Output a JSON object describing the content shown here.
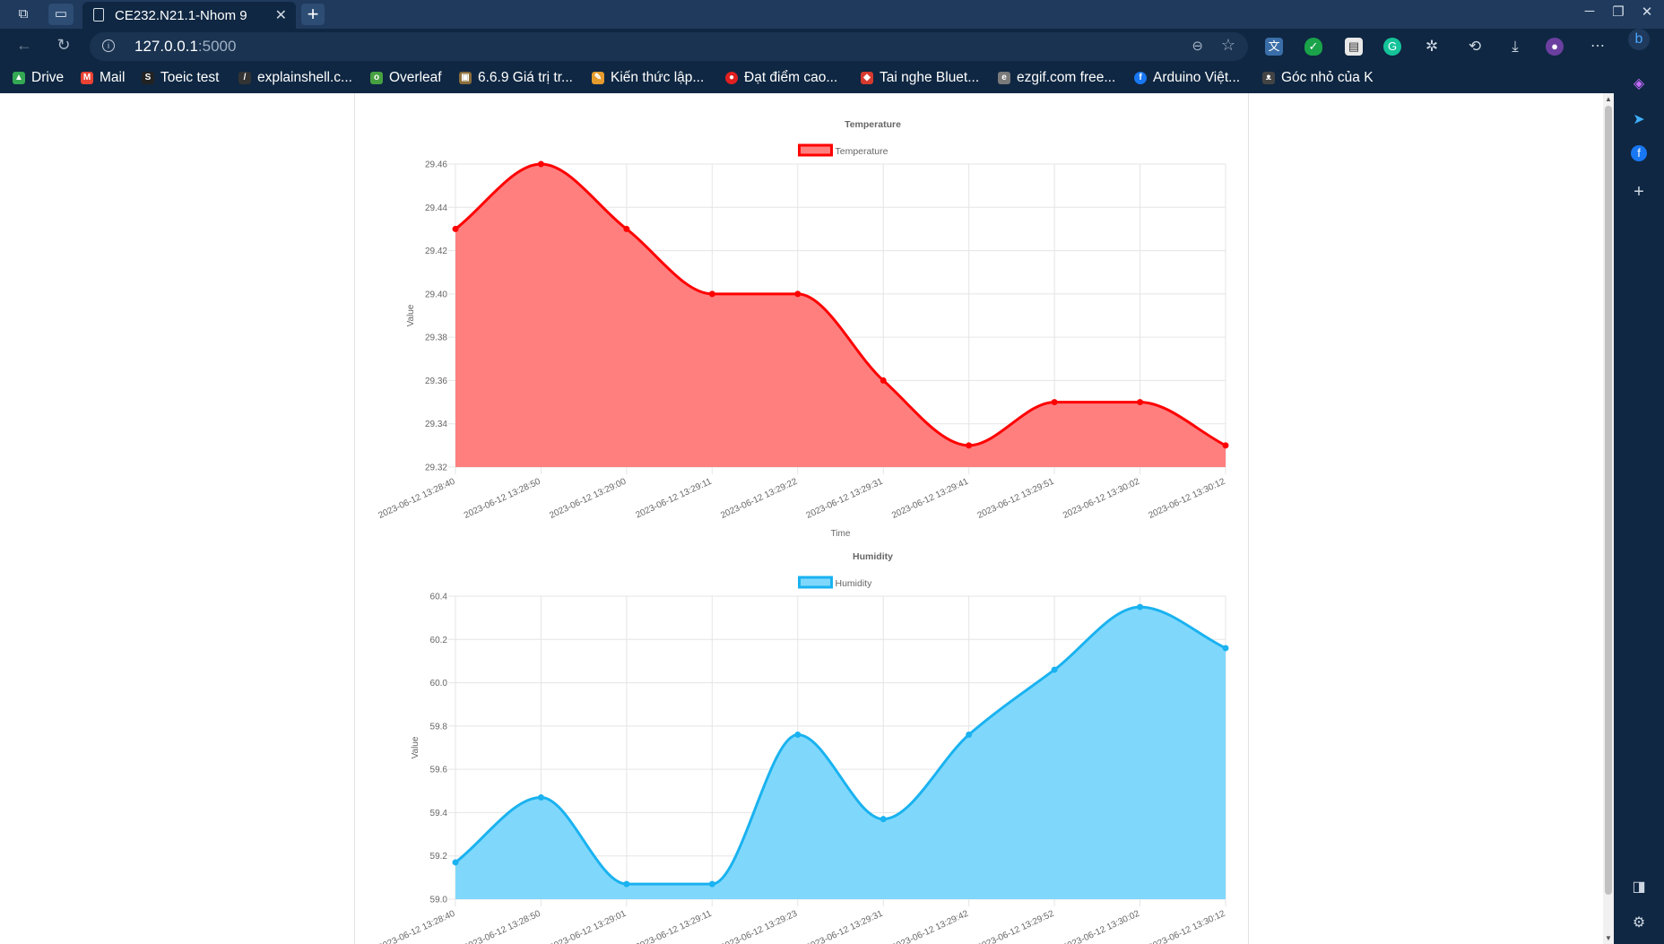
{
  "browser": {
    "tab_title": "CE232.N21.1-Nhom 9",
    "url_host": "127.0.0.1",
    "url_port": ":5000",
    "bookmarks": [
      {
        "label": "Drive",
        "icon": "drive-icon",
        "color": "#34a853"
      },
      {
        "label": "Mail",
        "icon": "gmail-icon",
        "color": "#ea4335"
      },
      {
        "label": "Toeic test",
        "icon": "toeic-icon",
        "color": "#222222"
      },
      {
        "label": "explainshell.c...",
        "icon": "explainshell-icon",
        "color": "#333333"
      },
      {
        "label": "Overleaf",
        "icon": "overleaf-icon",
        "color": "#47a141"
      },
      {
        "label": "6.6.9 Giá trị tr...",
        "icon": "site-icon",
        "color": "#8a6d3b"
      },
      {
        "label": "Kiến thức lập...",
        "icon": "pencil-icon",
        "color": "#e69b2d"
      },
      {
        "label": "Đạt điểm cao...",
        "icon": "red-circle-icon",
        "color": "#e02020"
      },
      {
        "label": "Tai nghe Bluet...",
        "icon": "shop-icon",
        "color": "#d63a2f"
      },
      {
        "label": "ezgif.com free...",
        "icon": "ezgif-icon",
        "color": "#7a7a7a"
      },
      {
        "label": "Arduino Việt...",
        "icon": "facebook-icon",
        "color": "#1877f2"
      },
      {
        "label": "Góc nhỏ của K",
        "icon": "cat-icon",
        "color": "#444444"
      }
    ]
  },
  "chart_data": [
    {
      "type": "area",
      "title": "Temperature",
      "legend": "Temperature",
      "xlabel": "Time",
      "ylabel": "Value",
      "color": "#ff0000",
      "fill": "#ff7f7f",
      "categories": [
        "2023-06-12 13:28:40",
        "2023-06-12 13:28:50",
        "2023-06-12 13:29:00",
        "2023-06-12 13:29:11",
        "2023-06-12 13:29:22",
        "2023-06-12 13:29:31",
        "2023-06-12 13:29:41",
        "2023-06-12 13:29:51",
        "2023-06-12 13:30:02",
        "2023-06-12 13:30:12"
      ],
      "values": [
        29.43,
        29.46,
        29.43,
        29.4,
        29.4,
        29.36,
        29.33,
        29.35,
        29.35,
        29.33
      ],
      "ylim": [
        29.32,
        29.46
      ],
      "yticks": [
        "29.46",
        "29.44",
        "29.42",
        "29.40",
        "29.38",
        "29.36",
        "29.34",
        "29.32"
      ],
      "grid": true,
      "legend_position": "top"
    },
    {
      "type": "area",
      "title": "Humidity",
      "legend": "Humidity",
      "xlabel": "",
      "ylabel": "Value",
      "color": "#1ab2f0",
      "fill": "#7fd8fc",
      "categories": [
        "2023-06-12 13:28:40",
        "2023-06-12 13:28:50",
        "2023-06-12 13:29:01",
        "2023-06-12 13:29:11",
        "2023-06-12 13:29:23",
        "2023-06-12 13:29:31",
        "2023-06-12 13:29:42",
        "2023-06-12 13:29:52",
        "2023-06-12 13:30:02",
        "2023-06-12 13:30:12"
      ],
      "values": [
        59.17,
        59.47,
        59.07,
        59.07,
        59.76,
        59.37,
        59.76,
        60.06,
        60.35,
        60.16
      ],
      "ylim": [
        59.0,
        60.4
      ],
      "yticks": [
        "60.4",
        "60.2",
        "60.0",
        "59.8",
        "59.6",
        "59.4",
        "59.2",
        "59.0"
      ],
      "grid": true,
      "legend_position": "top"
    }
  ]
}
